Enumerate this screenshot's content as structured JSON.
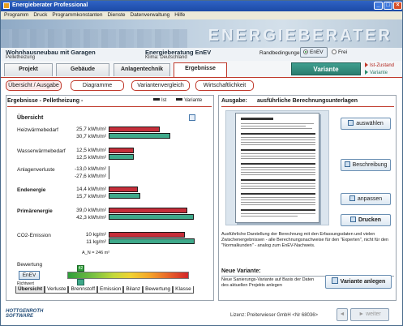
{
  "window": {
    "title": "Energieberater Professional",
    "menu": [
      "Programm",
      "Druck",
      "Programmkonstanten",
      "Dienste",
      "Datenverwaltung",
      "Hilfe"
    ]
  },
  "banner": {
    "brand": "Energieberater"
  },
  "project": {
    "title": "Wohnhausneubau mit Garagen",
    "subtitle": "Pelletheizung"
  },
  "consultant": {
    "title": "Energieberatung EnEV",
    "subtitle": "Klima: Deutschland"
  },
  "randbedingungen": {
    "label": "Randbedingungen:",
    "options": [
      "EnEV",
      "Frei"
    ],
    "selected": "EnEV"
  },
  "main_tabs": [
    "Projekt",
    "Gebäude",
    "Anlagentechnik",
    "Ergebnisse"
  ],
  "active_main_tab": "Ergebnisse",
  "variante_button": "Variante",
  "legend_right": {
    "ist": "Ist-Zustand",
    "variante": "Variante"
  },
  "sub_tabs": [
    "Übersicht / Ausgabe",
    "Diagramme",
    "Variantenvergleich",
    "Wirtschaftlichkeit"
  ],
  "left_panel": {
    "heading": "Ergebnisse - Pelletheizung -",
    "legend": {
      "ist": "Ist",
      "variante": "Variante"
    },
    "overview_title": "Übersicht",
    "rows": [
      {
        "label": "Heizwärmebedarf",
        "bold": false,
        "ist": "25,7 kWh/m²",
        "var": "30,7 kWh/m²",
        "ist_frac": 0.55,
        "var_frac": 0.66
      },
      {
        "label": "Wasserwärmebedarf",
        "bold": false,
        "ist": "12,5 kWh/m²",
        "var": "12,5 kWh/m²",
        "ist_frac": 0.27,
        "var_frac": 0.27
      },
      {
        "label": "Anlagenverluste",
        "bold": false,
        "ist": "-13,0 kWh/m²",
        "var": "-27,6 kWh/m²",
        "ist_frac": 0.0,
        "var_frac": 0.0
      },
      {
        "label": "Endenergie",
        "bold": true,
        "ist": "14,4 kWh/m²",
        "var": "15,7 kWh/m²",
        "ist_frac": 0.31,
        "var_frac": 0.34
      },
      {
        "label": "Primärenergie",
        "bold": true,
        "ist": "39,0 kWh/m²",
        "var": "42,3 kWh/m²",
        "ist_frac": 0.84,
        "var_frac": 0.91
      },
      {
        "label": "CO2-Emission",
        "bold": false,
        "ist": "10 kg/m²",
        "var": "11 kg/m²",
        "ist_frac": 0.82,
        "var_frac": 0.92
      }
    ],
    "an_note": "A_N = 246 m²",
    "bewertung_label": "Bewertung",
    "enev_button": "EnEV",
    "enev_sublabel": "Richtwert",
    "scale_marker_value": "42",
    "bottom_tabs": [
      "Übersicht",
      "Verluste",
      "Brennstoff",
      "Emission",
      "Bilanz",
      "Bewertung",
      "Klasse"
    ]
  },
  "right_panel": {
    "label": "Ausgabe:",
    "title": "ausführliche Berechnungsunterlagen",
    "buttons": [
      "auswählen",
      "Beschreibung",
      "anpassen",
      "Drucken"
    ],
    "description": "Ausführliche Darstellung der Berechnung mit den Erfassungsdaten und vielen Zwischenergebnissen - alle Berechnungsnachweise für den \"Experten\", nicht für den \"Normalkunden\" - analog zum EnEV-Nachweis.",
    "new_variant_title": "Neue Variante:",
    "new_variant_desc": "Neue Sanierungs-Variante auf Basis der Daten des aktuellen Projekts anlegen",
    "new_variant_button": "Variante anlegen"
  },
  "footer": {
    "logo_line1": "HOTTGENROTH",
    "logo_line2": "SOFTWARE",
    "license": "Lizenz: Preiterwieser GmbH  <Nr 68036>",
    "back": "",
    "next": "weiter"
  }
}
